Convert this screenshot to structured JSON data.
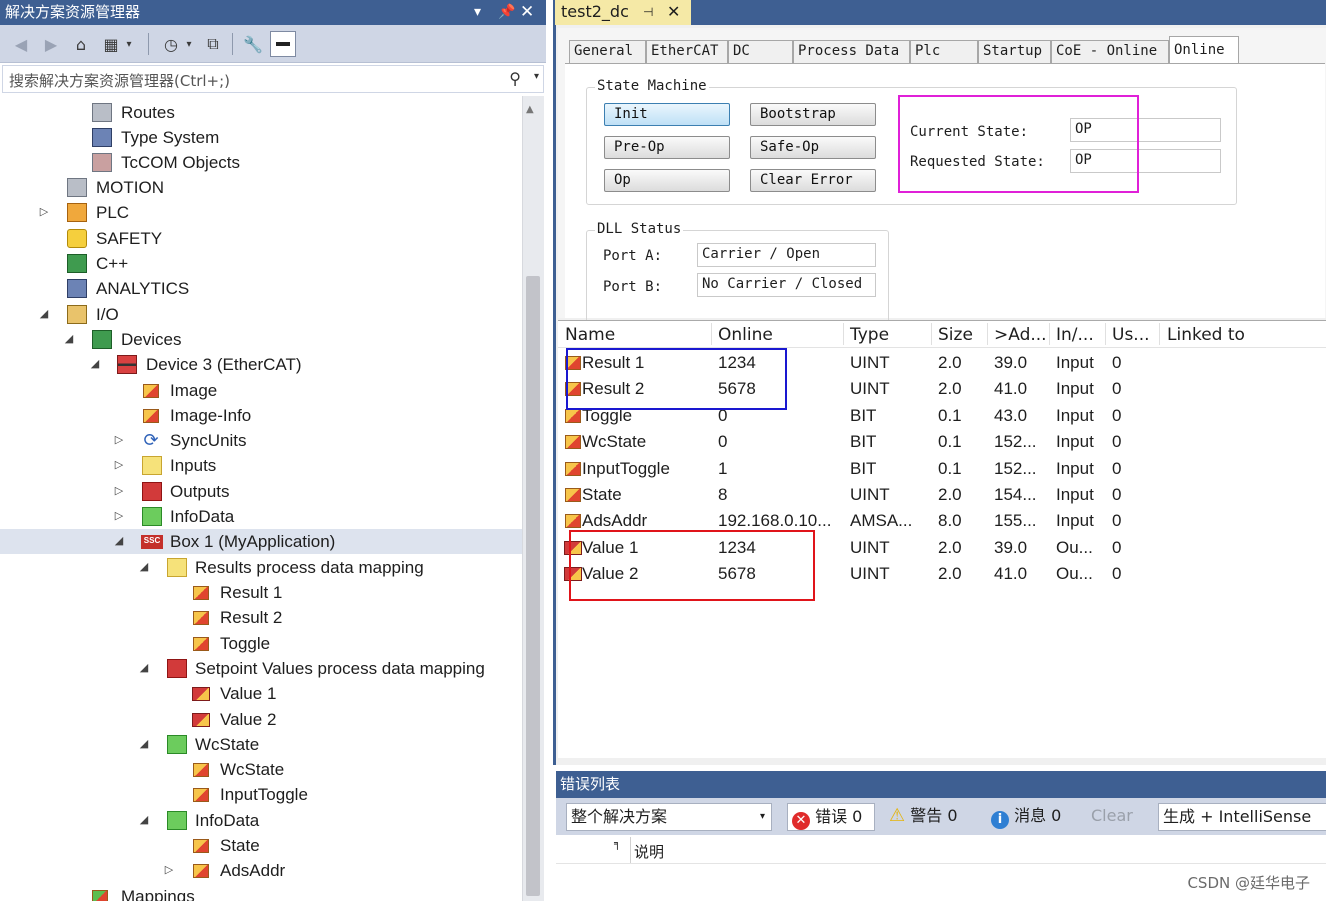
{
  "solution_explorer": {
    "title": "解决方案资源管理器",
    "search_placeholder": "搜索解决方案资源管理器(Ctrl+;)",
    "tree": [
      {
        "label": "Routes"
      },
      {
        "label": "Type System"
      },
      {
        "label": "TcCOM Objects"
      },
      {
        "label": "MOTION"
      },
      {
        "label": "PLC"
      },
      {
        "label": "SAFETY"
      },
      {
        "label": "C++"
      },
      {
        "label": "ANALYTICS"
      },
      {
        "label": "I/O"
      },
      {
        "label": "Devices"
      },
      {
        "label": "Device 3 (EtherCAT)"
      },
      {
        "label": "Image"
      },
      {
        "label": "Image-Info"
      },
      {
        "label": "SyncUnits"
      },
      {
        "label": "Inputs"
      },
      {
        "label": "Outputs"
      },
      {
        "label": "InfoData"
      },
      {
        "label": "Box 1 (MyApplication)"
      },
      {
        "label": "Results process data mapping"
      },
      {
        "label": "Result 1"
      },
      {
        "label": "Result 2"
      },
      {
        "label": "Toggle"
      },
      {
        "label": "Setpoint Values process data mapping"
      },
      {
        "label": "Value 1"
      },
      {
        "label": "Value 2"
      },
      {
        "label": "WcState"
      },
      {
        "label": "WcState"
      },
      {
        "label": "InputToggle"
      },
      {
        "label": "InfoData"
      },
      {
        "label": "State"
      },
      {
        "label": "AdsAddr"
      },
      {
        "label": "Mappings"
      }
    ],
    "box_icon_text": "SSC"
  },
  "document": {
    "tab_title": "test2_dc",
    "tabs": [
      "General",
      "EtherCAT",
      "DC",
      "Process Data",
      "Plc",
      "Startup",
      "CoE - Online",
      "Online"
    ],
    "active_tab": "Online",
    "state_machine": {
      "title": "State Machine",
      "buttons": [
        "Init",
        "Bootstrap",
        "Pre-Op",
        "Safe-Op",
        "Op",
        "Clear Error"
      ],
      "current_state_label": "Current State:",
      "current_state": "OP",
      "requested_state_label": "Requested State:",
      "requested_state": "OP"
    },
    "dll_status": {
      "title": "DLL Status",
      "port_a_label": "Port A:",
      "port_a": "Carrier / Open",
      "port_b_label": "Port B:",
      "port_b": "No Carrier / Closed"
    }
  },
  "variables": {
    "columns": [
      "Name",
      "Online",
      "Type",
      "Size",
      ">Ad...",
      "In/...",
      "Us...",
      "Linked to"
    ],
    "rows": [
      {
        "name": "Result 1",
        "online": "1234",
        "type": "UINT",
        "size": "2.0",
        "addr": "39.0",
        "inout": "Input",
        "user": "0"
      },
      {
        "name": "Result 2",
        "online": "5678",
        "type": "UINT",
        "size": "2.0",
        "addr": "41.0",
        "inout": "Input",
        "user": "0"
      },
      {
        "name": "Toggle",
        "online": "0",
        "type": "BIT",
        "size": "0.1",
        "addr": "43.0",
        "inout": "Input",
        "user": "0"
      },
      {
        "name": "WcState",
        "online": "0",
        "type": "BIT",
        "size": "0.1",
        "addr": "152...",
        "inout": "Input",
        "user": "0"
      },
      {
        "name": "InputToggle",
        "online": "1",
        "type": "BIT",
        "size": "0.1",
        "addr": "152...",
        "inout": "Input",
        "user": "0"
      },
      {
        "name": "State",
        "online": "8",
        "type": "UINT",
        "size": "2.0",
        "addr": "154...",
        "inout": "Input",
        "user": "0"
      },
      {
        "name": "AdsAddr",
        "online": "192.168.0.10...",
        "type": "AMSA...",
        "size": "8.0",
        "addr": "155...",
        "inout": "Input",
        "user": "0"
      },
      {
        "name": "Value 1",
        "online": "1234",
        "type": "UINT",
        "size": "2.0",
        "addr": "39.0",
        "inout": "Ou...",
        "user": "0"
      },
      {
        "name": "Value 2",
        "online": "5678",
        "type": "UINT",
        "size": "2.0",
        "addr": "41.0",
        "inout": "Ou...",
        "user": "0"
      }
    ]
  },
  "error_list": {
    "title": "错误列表",
    "scope": "整个解决方案",
    "errors": "错误 0",
    "warnings": "警告 0",
    "messages": "消息 0",
    "clear": "Clear",
    "build_filter": "生成 + IntelliSense",
    "column_description": "说明"
  },
  "watermark": "CSDN @廷华电子",
  "colors": {
    "title_bar": "#3e5f92",
    "toolbar": "#cfd6e5",
    "highlight_magenta": "#e020d8",
    "highlight_blue": "#1a18d0",
    "highlight_red": "#e0141a"
  }
}
